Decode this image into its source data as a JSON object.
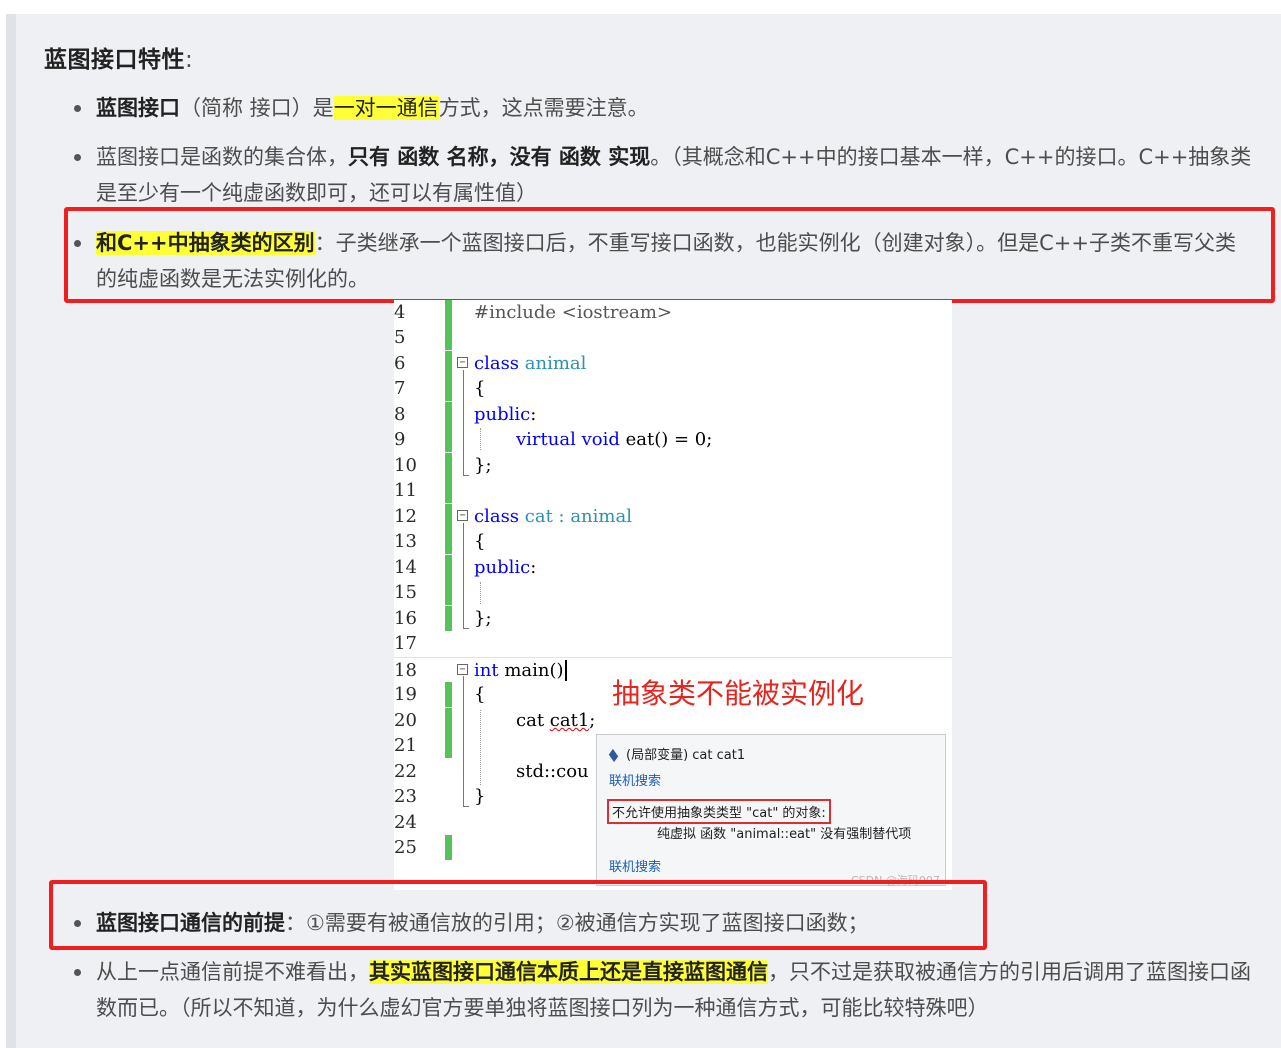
{
  "title": {
    "text": "蓝图接口特性",
    "colon": ":"
  },
  "items": [
    {
      "p1_bold": "蓝图接口",
      "p2": "（简称 接口）是",
      "p3_highlight": "一对一通信",
      "p4": "方式，这点需要注意。"
    },
    {
      "p1": "蓝图接口是函数的集合体，",
      "p2_bold": "只有 函数 名称，没有 函数 实现",
      "p3": "。（其概念和C++中的接口基本一样，C++的接口。C++抽象类是至少有一个纯虚函数即可，还可以有属性值）"
    },
    {
      "p1_highlight": "和C++中抽象类的区别",
      "p2": "：子类继承一个蓝图接口后，不重写接口函数，也能实例化（创建对象）。但是C++子类不重写父类的纯虚函数是无法实例化的。"
    },
    {
      "p1_bold": "蓝图接口通信的前提",
      "p2": "：①需要有被通信放的引用；②被通信方实现了蓝图接口函数；"
    },
    {
      "p1": "从上一点通信前提不难看出，",
      "p2_highlight": "其实蓝图接口通信本质上还是直接蓝图通信",
      "p3": "，只不过是获取被通信方的引用后调用了蓝图接口函数而已。（所以不知道，为什么虚幻官方要单独将蓝图接口列为一种通信方式，可能比较特殊吧）"
    }
  ],
  "code": {
    "line_numbers": [
      "4",
      "5",
      "6",
      "7",
      "8",
      "9",
      "10",
      "11",
      "12",
      "13",
      "14",
      "15",
      "16",
      "17",
      "18",
      "19",
      "20",
      "21",
      "22",
      "23",
      "24",
      "25"
    ],
    "l4": "#include <iostream>",
    "l6_kw": "class",
    "l6_name": " animal",
    "l7": "{",
    "l8_kw": "public",
    "l8_rest": ":",
    "l9_kw1": "virtual",
    "l9_kw2": "void",
    "l9_rest": " eat() = 0;",
    "l10": "};",
    "l12_kw": "class",
    "l12_rest": " cat : animal",
    "l13": "{",
    "l14_kw": "public",
    "l14_rest": ":",
    "l16": "};",
    "l18_kw": "int",
    "l18_rest": " main()",
    "l19": "{",
    "l20_a": "cat ",
    "l20_b": "cat1",
    "l20_c": ";",
    "l22": "std::cou",
    "l23": "}"
  },
  "annotation": "抽象类不能被实例化",
  "tooltip": {
    "line1": "(局部变量) cat cat1",
    "link1": "联机搜索",
    "error": "不允许使用抽象类类型 \"cat\" 的对象:",
    "error_detail": "纯虚拟 函数 \"animal::eat\" 没有强制替代项",
    "link2": "联机搜索",
    "watermark": "CSDN @海码007"
  }
}
